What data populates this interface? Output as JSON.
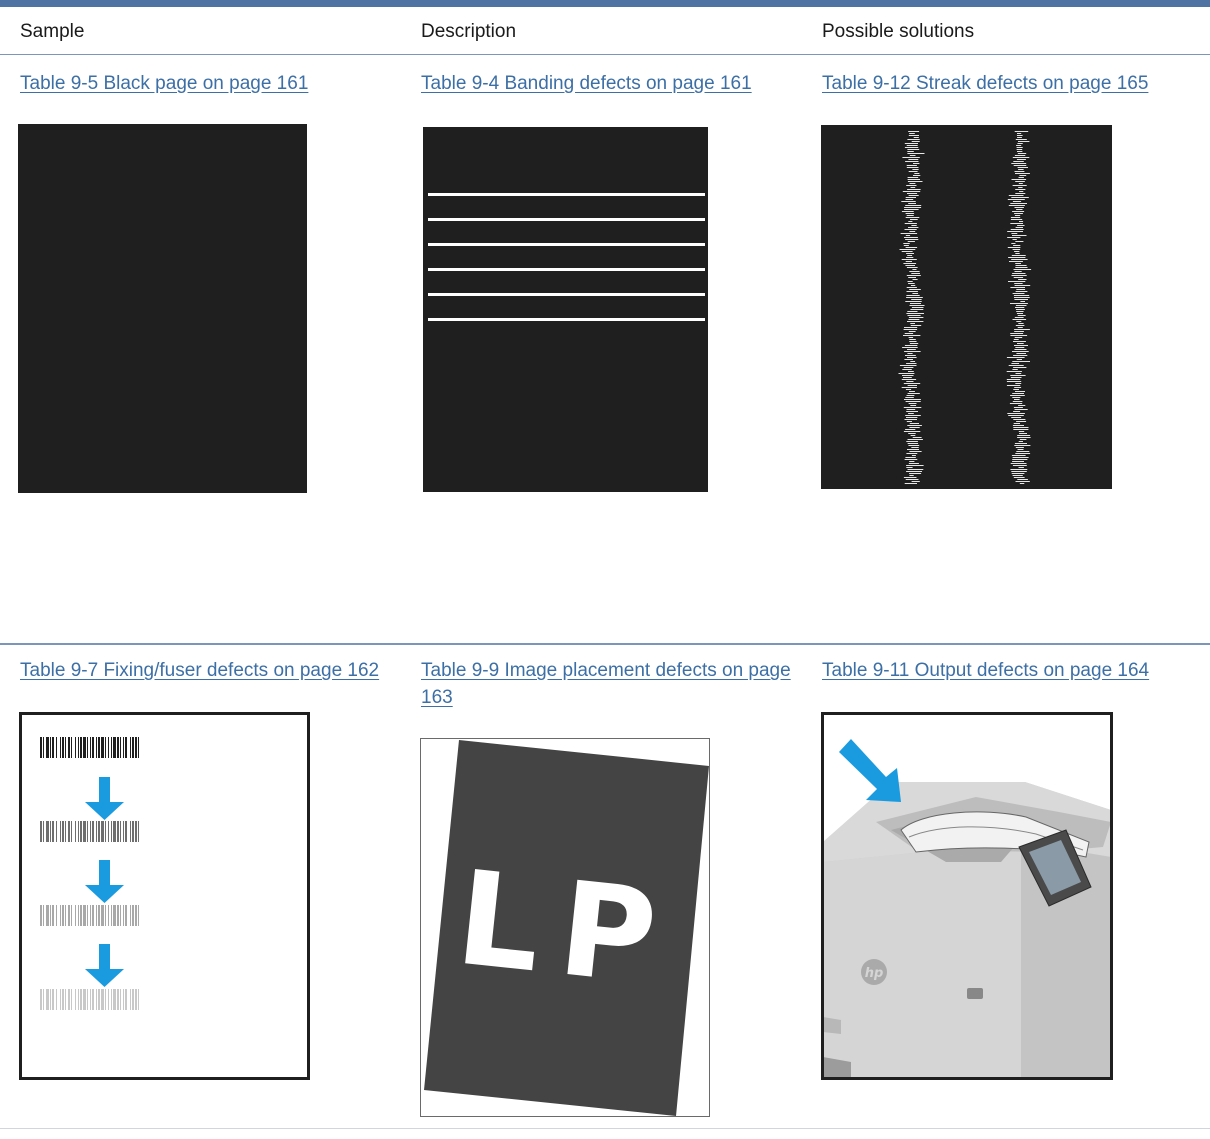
{
  "table": {
    "headers": [
      "Sample",
      "Description",
      "Possible solutions"
    ],
    "rows": [
      {
        "links": [
          "Table 9-5 Black page on page 161",
          "Table 9-4 Banding defects on page 161",
          "Table 9-12 Streak defects on page 165"
        ]
      },
      {
        "links": [
          "Table 9-7 Fixing/fuser defects on page 162",
          "Table 9-9 Image placement defects on page 163",
          "Table 9-11 Output defects on page 164"
        ]
      }
    ]
  },
  "image_placement_sample": {
    "letters": "LP"
  },
  "colors": {
    "link": "#3c6fa6",
    "rule": "#4f73a3",
    "arrow": "#1a9be0",
    "page_black": "#1f1f1f"
  },
  "icons": [
    "down-arrow-icon",
    "hp-logo-icon",
    "arrow-icon"
  ]
}
